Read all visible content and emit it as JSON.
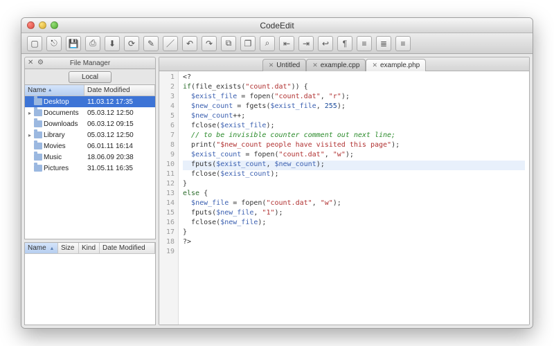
{
  "window": {
    "title": "CodeEdit"
  },
  "sidebar": {
    "panel_title": "File Manager",
    "segment_label": "Local",
    "columns": {
      "name": "Name",
      "date": "Date Modified"
    },
    "rows": [
      {
        "name": "Desktop",
        "date": "11.03.12 17:35",
        "expandable": false,
        "selected": true
      },
      {
        "name": "Documents",
        "date": "05.03.12 12:50",
        "expandable": true,
        "selected": false
      },
      {
        "name": "Downloads",
        "date": "06.03.12 09:15",
        "expandable": false,
        "selected": false
      },
      {
        "name": "Library",
        "date": "05.03.12 12:50",
        "expandable": true,
        "selected": false
      },
      {
        "name": "Movies",
        "date": "06.01.11 16:14",
        "expandable": false,
        "selected": false
      },
      {
        "name": "Music",
        "date": "18.06.09 20:38",
        "expandable": false,
        "selected": false
      },
      {
        "name": "Pictures",
        "date": "31.05.11 16:35",
        "expandable": false,
        "selected": false
      }
    ],
    "detail_columns": {
      "name": "Name",
      "size": "Size",
      "kind": "Kind",
      "date": "Date Modified"
    }
  },
  "editor": {
    "tabs": [
      {
        "label": "Untitled",
        "active": false
      },
      {
        "label": "example.cpp",
        "active": false
      },
      {
        "label": "example.php",
        "active": true
      }
    ],
    "highlight_line": 10,
    "lines": [
      {
        "n": 1,
        "tokens": [
          [
            "punct",
            "<?"
          ]
        ]
      },
      {
        "n": 2,
        "tokens": [
          [
            "kw",
            "if"
          ],
          [
            "punct",
            "("
          ],
          [
            "fn",
            "file_exists"
          ],
          [
            "punct",
            "("
          ],
          [
            "str",
            "\"count.dat\""
          ],
          [
            "punct",
            ")) {"
          ]
        ]
      },
      {
        "n": 3,
        "tokens": [
          [
            "punct",
            "  "
          ],
          [
            "var",
            "$exist_file"
          ],
          [
            "punct",
            " = "
          ],
          [
            "fn",
            "fopen"
          ],
          [
            "punct",
            "("
          ],
          [
            "str",
            "\"count.dat\""
          ],
          [
            "punct",
            ", "
          ],
          [
            "str",
            "\"r\""
          ],
          [
            "punct",
            ");"
          ]
        ]
      },
      {
        "n": 4,
        "tokens": [
          [
            "punct",
            "  "
          ],
          [
            "var",
            "$new_count"
          ],
          [
            "punct",
            " = "
          ],
          [
            "fn",
            "fgets"
          ],
          [
            "punct",
            "("
          ],
          [
            "var",
            "$exist_file"
          ],
          [
            "punct",
            ", "
          ],
          [
            "num",
            "255"
          ],
          [
            "punct",
            ");"
          ]
        ]
      },
      {
        "n": 5,
        "tokens": [
          [
            "punct",
            "  "
          ],
          [
            "var",
            "$new_count"
          ],
          [
            "punct",
            "++;"
          ]
        ]
      },
      {
        "n": 6,
        "tokens": [
          [
            "punct",
            "  "
          ],
          [
            "fn",
            "fclose"
          ],
          [
            "punct",
            "("
          ],
          [
            "var",
            "$exist_file"
          ],
          [
            "punct",
            ");"
          ]
        ]
      },
      {
        "n": 7,
        "tokens": [
          [
            "punct",
            "  "
          ],
          [
            "cmt",
            "// to be invisible counter comment out next line;"
          ]
        ]
      },
      {
        "n": 8,
        "tokens": [
          [
            "punct",
            "  "
          ],
          [
            "fn",
            "print"
          ],
          [
            "punct",
            "("
          ],
          [
            "str",
            "\"$new_count people have visited this page\""
          ],
          [
            "punct",
            ");"
          ]
        ]
      },
      {
        "n": 9,
        "tokens": [
          [
            "punct",
            "  "
          ],
          [
            "var",
            "$exist_count"
          ],
          [
            "punct",
            " = "
          ],
          [
            "fn",
            "fopen"
          ],
          [
            "punct",
            "("
          ],
          [
            "str",
            "\"count.dat\""
          ],
          [
            "punct",
            ", "
          ],
          [
            "str",
            "\"w\""
          ],
          [
            "punct",
            ");"
          ]
        ]
      },
      {
        "n": 10,
        "tokens": [
          [
            "punct",
            "  "
          ],
          [
            "fn",
            "fputs"
          ],
          [
            "punct",
            "("
          ],
          [
            "var",
            "$exist_count"
          ],
          [
            "punct",
            ", "
          ],
          [
            "var",
            "$new_count"
          ],
          [
            "punct",
            ");"
          ]
        ]
      },
      {
        "n": 11,
        "tokens": [
          [
            "punct",
            "  "
          ],
          [
            "fn",
            "fclose"
          ],
          [
            "punct",
            "("
          ],
          [
            "var",
            "$exist_count"
          ],
          [
            "punct",
            ");"
          ]
        ]
      },
      {
        "n": 12,
        "tokens": [
          [
            "punct",
            "}"
          ]
        ]
      },
      {
        "n": 13,
        "tokens": [
          [
            "kw",
            "else"
          ],
          [
            "punct",
            " {"
          ]
        ]
      },
      {
        "n": 14,
        "tokens": [
          [
            "punct",
            "  "
          ],
          [
            "var",
            "$new_file"
          ],
          [
            "punct",
            " = "
          ],
          [
            "fn",
            "fopen"
          ],
          [
            "punct",
            "("
          ],
          [
            "str",
            "\"count.dat\""
          ],
          [
            "punct",
            ", "
          ],
          [
            "str",
            "\"w\""
          ],
          [
            "punct",
            ");"
          ]
        ]
      },
      {
        "n": 15,
        "tokens": [
          [
            "punct",
            "  "
          ],
          [
            "fn",
            "fputs"
          ],
          [
            "punct",
            "("
          ],
          [
            "var",
            "$new_file"
          ],
          [
            "punct",
            ", "
          ],
          [
            "str",
            "\"1\""
          ],
          [
            "punct",
            ");"
          ]
        ]
      },
      {
        "n": 16,
        "tokens": [
          [
            "punct",
            "  "
          ],
          [
            "fn",
            "fclose"
          ],
          [
            "punct",
            "("
          ],
          [
            "var",
            "$new_file"
          ],
          [
            "punct",
            ");"
          ]
        ]
      },
      {
        "n": 17,
        "tokens": [
          [
            "punct",
            "}"
          ]
        ]
      },
      {
        "n": 18,
        "tokens": [
          [
            "punct",
            "?>"
          ]
        ]
      },
      {
        "n": 19,
        "tokens": []
      }
    ]
  },
  "toolbar": {
    "buttons": [
      "new-file",
      "open-file",
      "save-file",
      "save-all",
      "save-as",
      "reload",
      "edit",
      "highlight",
      "undo",
      "redo",
      "copy",
      "duplicate",
      "find",
      "outdent",
      "indent",
      "wrap",
      "pilcrow",
      "align-left",
      "align-center",
      "align-right"
    ],
    "glyphs": {
      "new-file": "▢",
      "open-file": "⎋",
      "save-file": "💾",
      "save-all": "⎙",
      "save-as": "⬇",
      "reload": "⟳",
      "edit": "✎",
      "highlight": "／",
      "undo": "↶",
      "redo": "↷",
      "copy": "⧉",
      "duplicate": "❐",
      "find": "⌕",
      "outdent": "⇤",
      "indent": "⇥",
      "wrap": "↩",
      "pilcrow": "¶",
      "align-left": "≡",
      "align-center": "≣",
      "align-right": "≡"
    }
  }
}
